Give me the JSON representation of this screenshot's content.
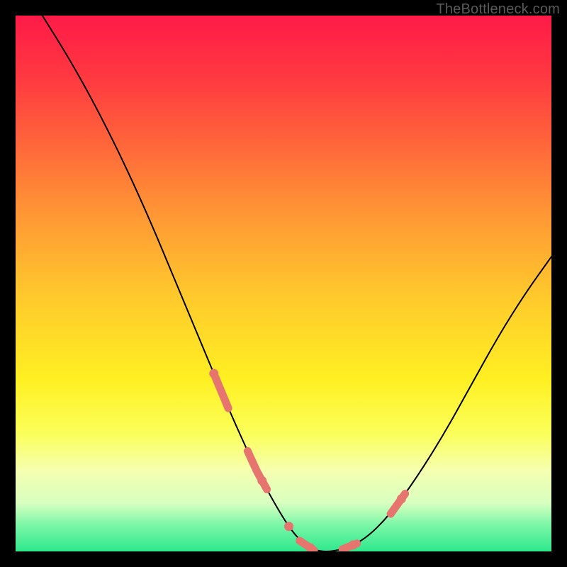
{
  "watermark": "TheBottleneck.com",
  "chart_data": {
    "type": "line",
    "title": "",
    "xlabel": "",
    "ylabel": "",
    "xlim": [
      0,
      100
    ],
    "ylim": [
      0,
      100
    ],
    "series": [
      {
        "name": "curve",
        "x": [
          5,
          10,
          15,
          20,
          25,
          30,
          35,
          40,
          45,
          50,
          53,
          56,
          60,
          65,
          70,
          75,
          80,
          85,
          90,
          95,
          100
        ],
        "y": [
          100,
          92,
          83,
          73,
          62,
          50,
          38,
          26,
          15,
          6,
          2,
          0,
          0,
          2,
          7,
          14,
          22,
          31,
          40,
          48,
          55
        ]
      }
    ],
    "highlight_segments": [
      {
        "x_start": 37,
        "x_end": 50
      },
      {
        "x_start": 53,
        "x_end": 58
      },
      {
        "x_start": 61,
        "x_end": 67
      },
      {
        "x_start": 70,
        "x_end": 76
      }
    ],
    "highlight_dot_x": [
      37,
      46,
      51,
      55,
      63,
      72
    ]
  }
}
